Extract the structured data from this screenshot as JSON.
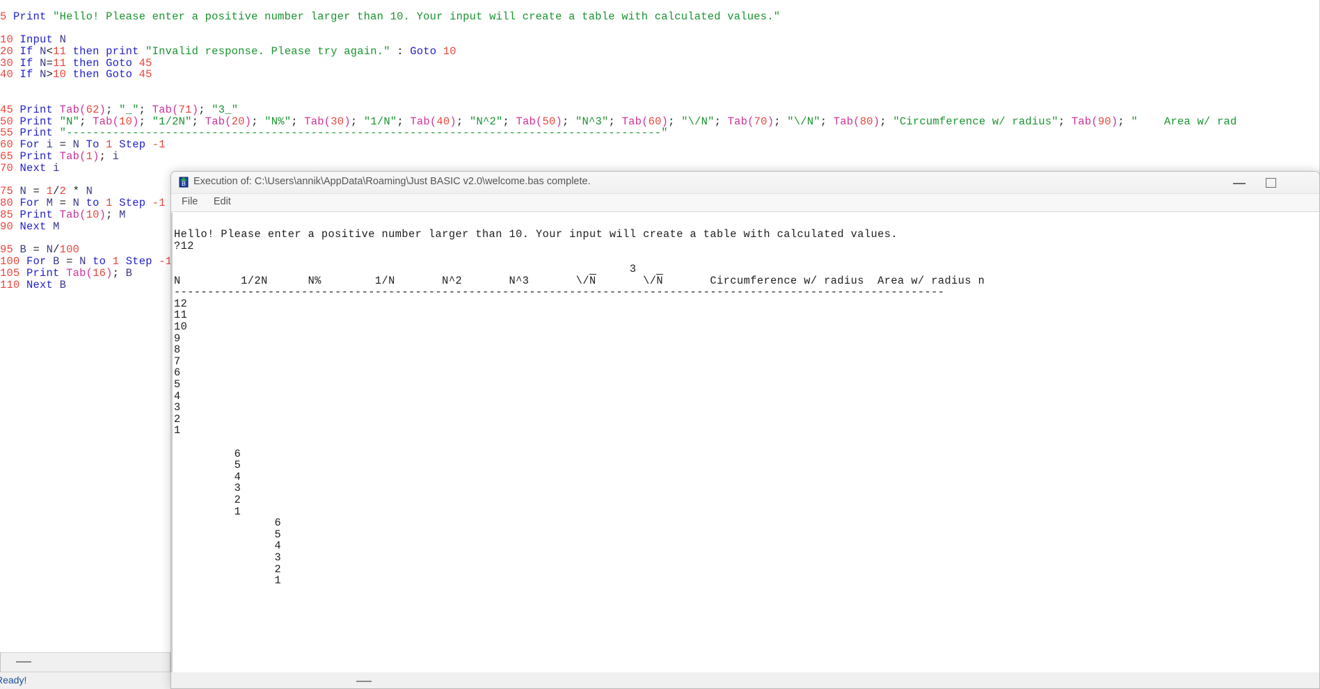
{
  "ide": {
    "status_text": "Ready!",
    "code_lines": [
      [
        {
          "t": "num",
          "v": "5"
        },
        {
          "t": "sp",
          "v": " "
        },
        {
          "t": "kw",
          "v": "Print"
        },
        {
          "t": "sp",
          "v": " "
        },
        {
          "t": "str",
          "v": "\"Hello! Please enter a positive number larger than 10. Your input will create a table with calculated values.\""
        }
      ],
      [],
      [
        {
          "t": "num",
          "v": "10"
        },
        {
          "t": "sp",
          "v": " "
        },
        {
          "t": "kw",
          "v": "Input"
        },
        {
          "t": "sp",
          "v": " "
        },
        {
          "t": "var",
          "v": "N"
        }
      ],
      [
        {
          "t": "num",
          "v": "20"
        },
        {
          "t": "sp",
          "v": " "
        },
        {
          "t": "kw",
          "v": "If"
        },
        {
          "t": "sp",
          "v": " "
        },
        {
          "t": "var",
          "v": "N"
        },
        {
          "t": "op",
          "v": "<"
        },
        {
          "t": "num",
          "v": "11"
        },
        {
          "t": "sp",
          "v": " "
        },
        {
          "t": "kw",
          "v": "then print"
        },
        {
          "t": "sp",
          "v": " "
        },
        {
          "t": "str",
          "v": "\"Invalid response. Please try again.\""
        },
        {
          "t": "op",
          "v": " : "
        },
        {
          "t": "kw",
          "v": "Goto"
        },
        {
          "t": "sp",
          "v": " "
        },
        {
          "t": "num",
          "v": "10"
        }
      ],
      [
        {
          "t": "num",
          "v": "30"
        },
        {
          "t": "sp",
          "v": " "
        },
        {
          "t": "kw",
          "v": "If"
        },
        {
          "t": "sp",
          "v": " "
        },
        {
          "t": "var",
          "v": "N"
        },
        {
          "t": "op",
          "v": "="
        },
        {
          "t": "num",
          "v": "11"
        },
        {
          "t": "sp",
          "v": " "
        },
        {
          "t": "kw",
          "v": "then Goto"
        },
        {
          "t": "sp",
          "v": " "
        },
        {
          "t": "num",
          "v": "45"
        }
      ],
      [
        {
          "t": "num",
          "v": "40"
        },
        {
          "t": "sp",
          "v": " "
        },
        {
          "t": "kw",
          "v": "If"
        },
        {
          "t": "sp",
          "v": " "
        },
        {
          "t": "var",
          "v": "N"
        },
        {
          "t": "op",
          "v": ">"
        },
        {
          "t": "num",
          "v": "10"
        },
        {
          "t": "sp",
          "v": " "
        },
        {
          "t": "kw",
          "v": "then Goto"
        },
        {
          "t": "sp",
          "v": " "
        },
        {
          "t": "num",
          "v": "45"
        }
      ],
      [],
      [],
      [
        {
          "t": "num",
          "v": "45"
        },
        {
          "t": "sp",
          "v": " "
        },
        {
          "t": "kw",
          "v": "Print"
        },
        {
          "t": "sp",
          "v": " "
        },
        {
          "t": "fn",
          "v": "Tab("
        },
        {
          "t": "num",
          "v": "62"
        },
        {
          "t": "fn",
          "v": ")"
        },
        {
          "t": "op",
          "v": "; "
        },
        {
          "t": "str",
          "v": "\"_\""
        },
        {
          "t": "op",
          "v": "; "
        },
        {
          "t": "fn",
          "v": "Tab("
        },
        {
          "t": "num",
          "v": "71"
        },
        {
          "t": "fn",
          "v": ")"
        },
        {
          "t": "op",
          "v": "; "
        },
        {
          "t": "str",
          "v": "\"3_\""
        }
      ],
      [
        {
          "t": "num",
          "v": "50"
        },
        {
          "t": "sp",
          "v": " "
        },
        {
          "t": "kw",
          "v": "Print"
        },
        {
          "t": "sp",
          "v": " "
        },
        {
          "t": "str",
          "v": "\"N\""
        },
        {
          "t": "op",
          "v": "; "
        },
        {
          "t": "fn",
          "v": "Tab("
        },
        {
          "t": "num",
          "v": "10"
        },
        {
          "t": "fn",
          "v": ")"
        },
        {
          "t": "op",
          "v": "; "
        },
        {
          "t": "str",
          "v": "\"1/2N\""
        },
        {
          "t": "op",
          "v": "; "
        },
        {
          "t": "fn",
          "v": "Tab("
        },
        {
          "t": "num",
          "v": "20"
        },
        {
          "t": "fn",
          "v": ")"
        },
        {
          "t": "op",
          "v": "; "
        },
        {
          "t": "str",
          "v": "\"N%\""
        },
        {
          "t": "op",
          "v": "; "
        },
        {
          "t": "fn",
          "v": "Tab("
        },
        {
          "t": "num",
          "v": "30"
        },
        {
          "t": "fn",
          "v": ")"
        },
        {
          "t": "op",
          "v": "; "
        },
        {
          "t": "str",
          "v": "\"1/N\""
        },
        {
          "t": "op",
          "v": "; "
        },
        {
          "t": "fn",
          "v": "Tab("
        },
        {
          "t": "num",
          "v": "40"
        },
        {
          "t": "fn",
          "v": ")"
        },
        {
          "t": "op",
          "v": "; "
        },
        {
          "t": "str",
          "v": "\"N^2\""
        },
        {
          "t": "op",
          "v": "; "
        },
        {
          "t": "fn",
          "v": "Tab("
        },
        {
          "t": "num",
          "v": "50"
        },
        {
          "t": "fn",
          "v": ")"
        },
        {
          "t": "op",
          "v": "; "
        },
        {
          "t": "str",
          "v": "\"N^3\""
        },
        {
          "t": "op",
          "v": "; "
        },
        {
          "t": "fn",
          "v": "Tab("
        },
        {
          "t": "num",
          "v": "60"
        },
        {
          "t": "fn",
          "v": ")"
        },
        {
          "t": "op",
          "v": "; "
        },
        {
          "t": "str",
          "v": "\"\\/N\""
        },
        {
          "t": "op",
          "v": "; "
        },
        {
          "t": "fn",
          "v": "Tab("
        },
        {
          "t": "num",
          "v": "70"
        },
        {
          "t": "fn",
          "v": ")"
        },
        {
          "t": "op",
          "v": "; "
        },
        {
          "t": "str",
          "v": "\"\\/N\""
        },
        {
          "t": "op",
          "v": "; "
        },
        {
          "t": "fn",
          "v": "Tab("
        },
        {
          "t": "num",
          "v": "80"
        },
        {
          "t": "fn",
          "v": ")"
        },
        {
          "t": "op",
          "v": "; "
        },
        {
          "t": "str",
          "v": "\"Circumference w/ radius\""
        },
        {
          "t": "op",
          "v": "; "
        },
        {
          "t": "fn",
          "v": "Tab("
        },
        {
          "t": "num",
          "v": "90"
        },
        {
          "t": "fn",
          "v": ")"
        },
        {
          "t": "op",
          "v": "; "
        },
        {
          "t": "str",
          "v": "\"    Area w/ rad"
        }
      ],
      [
        {
          "t": "num",
          "v": "55"
        },
        {
          "t": "sp",
          "v": " "
        },
        {
          "t": "kw",
          "v": "Print"
        },
        {
          "t": "sp",
          "v": " "
        },
        {
          "t": "str",
          "v": "\"------------------------------------------------------------------------------------------\""
        }
      ],
      [
        {
          "t": "num",
          "v": "60"
        },
        {
          "t": "sp",
          "v": " "
        },
        {
          "t": "kw",
          "v": "For"
        },
        {
          "t": "sp",
          "v": " "
        },
        {
          "t": "var",
          "v": "i"
        },
        {
          "t": "op",
          "v": " = "
        },
        {
          "t": "var",
          "v": "N"
        },
        {
          "t": "sp",
          "v": " "
        },
        {
          "t": "kw",
          "v": "To"
        },
        {
          "t": "sp",
          "v": " "
        },
        {
          "t": "num",
          "v": "1"
        },
        {
          "t": "sp",
          "v": " "
        },
        {
          "t": "kw",
          "v": "Step"
        },
        {
          "t": "sp",
          "v": " "
        },
        {
          "t": "num",
          "v": "-1"
        }
      ],
      [
        {
          "t": "num",
          "v": "65"
        },
        {
          "t": "sp",
          "v": " "
        },
        {
          "t": "kw",
          "v": "Print"
        },
        {
          "t": "sp",
          "v": " "
        },
        {
          "t": "fn",
          "v": "Tab("
        },
        {
          "t": "num",
          "v": "1"
        },
        {
          "t": "fn",
          "v": ")"
        },
        {
          "t": "op",
          "v": "; "
        },
        {
          "t": "var",
          "v": "i"
        }
      ],
      [
        {
          "t": "num",
          "v": "70"
        },
        {
          "t": "sp",
          "v": " "
        },
        {
          "t": "kw",
          "v": "Next"
        },
        {
          "t": "sp",
          "v": " "
        },
        {
          "t": "var",
          "v": "i"
        }
      ],
      [],
      [
        {
          "t": "num",
          "v": "75"
        },
        {
          "t": "sp",
          "v": " "
        },
        {
          "t": "var",
          "v": "N"
        },
        {
          "t": "op",
          "v": " = "
        },
        {
          "t": "num",
          "v": "1"
        },
        {
          "t": "op",
          "v": "/"
        },
        {
          "t": "num",
          "v": "2"
        },
        {
          "t": "op",
          "v": " * "
        },
        {
          "t": "var",
          "v": "N"
        }
      ],
      [
        {
          "t": "num",
          "v": "80"
        },
        {
          "t": "sp",
          "v": " "
        },
        {
          "t": "kw",
          "v": "For"
        },
        {
          "t": "sp",
          "v": " "
        },
        {
          "t": "var",
          "v": "M"
        },
        {
          "t": "op",
          "v": " = "
        },
        {
          "t": "var",
          "v": "N"
        },
        {
          "t": "sp",
          "v": " "
        },
        {
          "t": "kw",
          "v": "to"
        },
        {
          "t": "sp",
          "v": " "
        },
        {
          "t": "num",
          "v": "1"
        },
        {
          "t": "sp",
          "v": " "
        },
        {
          "t": "kw",
          "v": "Step"
        },
        {
          "t": "sp",
          "v": " "
        },
        {
          "t": "num",
          "v": "-1"
        }
      ],
      [
        {
          "t": "num",
          "v": "85"
        },
        {
          "t": "sp",
          "v": " "
        },
        {
          "t": "kw",
          "v": "Print"
        },
        {
          "t": "sp",
          "v": " "
        },
        {
          "t": "fn",
          "v": "Tab("
        },
        {
          "t": "num",
          "v": "10"
        },
        {
          "t": "fn",
          "v": ")"
        },
        {
          "t": "op",
          "v": "; "
        },
        {
          "t": "var",
          "v": "M"
        }
      ],
      [
        {
          "t": "num",
          "v": "90"
        },
        {
          "t": "sp",
          "v": " "
        },
        {
          "t": "kw",
          "v": "Next"
        },
        {
          "t": "sp",
          "v": " "
        },
        {
          "t": "var",
          "v": "M"
        }
      ],
      [],
      [
        {
          "t": "num",
          "v": "95"
        },
        {
          "t": "sp",
          "v": " "
        },
        {
          "t": "var",
          "v": "B"
        },
        {
          "t": "op",
          "v": " = "
        },
        {
          "t": "var",
          "v": "N"
        },
        {
          "t": "op",
          "v": "/"
        },
        {
          "t": "num",
          "v": "100"
        }
      ],
      [
        {
          "t": "num",
          "v": "100"
        },
        {
          "t": "sp",
          "v": " "
        },
        {
          "t": "kw",
          "v": "For"
        },
        {
          "t": "sp",
          "v": " "
        },
        {
          "t": "var",
          "v": "B"
        },
        {
          "t": "op",
          "v": " = "
        },
        {
          "t": "var",
          "v": "N"
        },
        {
          "t": "sp",
          "v": " "
        },
        {
          "t": "kw",
          "v": "to"
        },
        {
          "t": "sp",
          "v": " "
        },
        {
          "t": "num",
          "v": "1"
        },
        {
          "t": "sp",
          "v": " "
        },
        {
          "t": "kw",
          "v": "Step"
        },
        {
          "t": "sp",
          "v": " "
        },
        {
          "t": "num",
          "v": "-1"
        }
      ],
      [
        {
          "t": "num",
          "v": "105"
        },
        {
          "t": "sp",
          "v": " "
        },
        {
          "t": "kw",
          "v": "Print"
        },
        {
          "t": "sp",
          "v": " "
        },
        {
          "t": "fn",
          "v": "Tab("
        },
        {
          "t": "num",
          "v": "16"
        },
        {
          "t": "fn",
          "v": ")"
        },
        {
          "t": "op",
          "v": "; "
        },
        {
          "t": "var",
          "v": "B"
        }
      ],
      [
        {
          "t": "num",
          "v": "110"
        },
        {
          "t": "sp",
          "v": " "
        },
        {
          "t": "kw",
          "v": "Next"
        },
        {
          "t": "sp",
          "v": " "
        },
        {
          "t": "var",
          "v": "B"
        }
      ]
    ]
  },
  "exec_window": {
    "title": "Execution of: C:\\Users\\annik\\AppData\\Roaming\\Just BASIC v2.0\\welcome.bas complete.",
    "icon_label": "just-basic-icon",
    "menu": [
      "File",
      "Edit"
    ],
    "window_buttons": {
      "minimize": "—",
      "maximize": "□"
    },
    "console": {
      "intro_line": "Hello! Please enter a positive number larger than 10. Your input will create a table with calculated values.",
      "input_line": "?12",
      "header_sup": "                                                                    3",
      "headers": [
        "N",
        "1/2N",
        "N%",
        "1/N",
        "N^2",
        "N^3",
        "\\/N",
        "\\/N",
        "Circumference w/ radius",
        "Area w/ radius n"
      ],
      "header_row": "N         1/2N      N%        1/N       N^2       N^3       \\/N       \\/N       Circumference w/ radius     Area w/ radius n",
      "separator": "-------------------------------------------------------------------------------------------------------------------",
      "col1_values": [
        "12",
        "11",
        "10",
        "9",
        "8",
        "7",
        "6",
        "5",
        "4",
        "3",
        "2",
        "1"
      ],
      "col2_values": [
        "6",
        "5",
        "4",
        "3",
        "2",
        "1"
      ],
      "col3_values": [
        "6",
        "5",
        "4",
        "3",
        "2",
        "1"
      ],
      "col1_indent": 0,
      "col2_indent": 9,
      "col3_indent": 15
    }
  }
}
